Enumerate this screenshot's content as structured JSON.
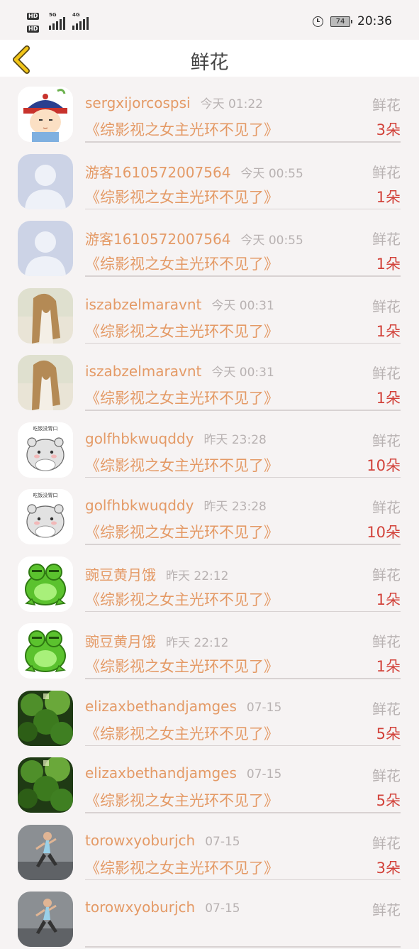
{
  "status_bar": {
    "hd1": "HD",
    "hd2": "HD",
    "net1": "5G",
    "net2": "4G",
    "battery": "74",
    "time": "20:36"
  },
  "header": {
    "title": "鲜花"
  },
  "rows": [
    {
      "name": "sergxijorcospsi",
      "time": "今天 01:22",
      "gift": "鲜花",
      "book": "《综影视之女主光环不见了》",
      "count": "3朵",
      "avatar": "chef-cartoon"
    },
    {
      "name": "游客1610572007564",
      "time": "今天 00:55",
      "gift": "鲜花",
      "book": "《综影视之女主光环不见了》",
      "count": "1朵",
      "avatar": "default-person"
    },
    {
      "name": "游客1610572007564",
      "time": "今天 00:55",
      "gift": "鲜花",
      "book": "《综影视之女主光环不见了》",
      "count": "1朵",
      "avatar": "default-person"
    },
    {
      "name": "iszabzelmaravnt",
      "time": "今天 00:31",
      "gift": "鲜花",
      "book": "《综影视之女主光环不见了》",
      "count": "1朵",
      "avatar": "woman-photo"
    },
    {
      "name": "iszabzelmaravnt",
      "time": "今天 00:31",
      "gift": "鲜花",
      "book": "《综影视之女主光环不见了》",
      "count": "1朵",
      "avatar": "woman-photo"
    },
    {
      "name": "golfhbkwuqddy",
      "time": "昨天 23:28",
      "gift": "鲜花",
      "book": "《综影视之女主光环不见了》",
      "count": "10朵",
      "avatar": "hamster"
    },
    {
      "name": "golfhbkwuqddy",
      "time": "昨天 23:28",
      "gift": "鲜花",
      "book": "《综影视之女主光环不见了》",
      "count": "10朵",
      "avatar": "hamster"
    },
    {
      "name": "豌豆黄月饿",
      "time": "昨天 22:12",
      "gift": "鲜花",
      "book": "《综影视之女主光环不见了》",
      "count": "1朵",
      "avatar": "frog"
    },
    {
      "name": "豌豆黄月饿",
      "time": "昨天 22:12",
      "gift": "鲜花",
      "book": "《综影视之女主光环不见了》",
      "count": "1朵",
      "avatar": "frog"
    },
    {
      "name": "elizaxbethandjamges",
      "time": "07-15",
      "gift": "鲜花",
      "book": "《综影视之女主光环不见了》",
      "count": "5朵",
      "avatar": "forest"
    },
    {
      "name": "elizaxbethandjamges",
      "time": "07-15",
      "gift": "鲜花",
      "book": "《综影视之女主光环不见了》",
      "count": "5朵",
      "avatar": "forest"
    },
    {
      "name": "torowxyoburjch",
      "time": "07-15",
      "gift": "鲜花",
      "book": "《综影视之女主光环不见了》",
      "count": "3朵",
      "avatar": "runner"
    },
    {
      "name": "torowxyoburjch",
      "time": "07-15",
      "gift": "鲜花",
      "book": "",
      "count": "",
      "avatar": "runner"
    }
  ],
  "colors": {
    "name": "#e49a66",
    "count": "#d2423a",
    "muted": "#b8b2b2",
    "back_arrow": "#f2c518"
  }
}
